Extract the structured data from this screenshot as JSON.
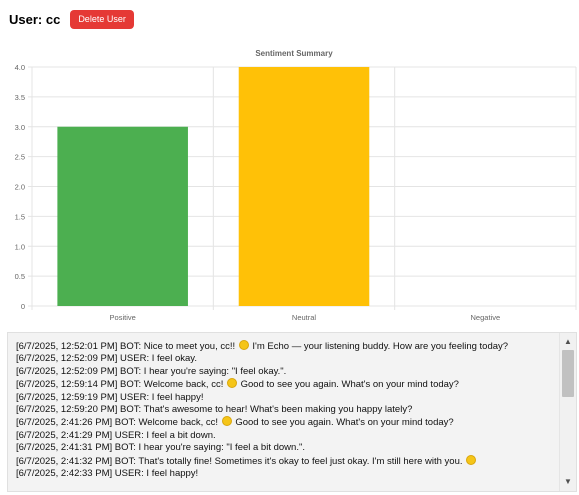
{
  "header": {
    "user_title": "User: cc",
    "delete_label": "Delete User"
  },
  "colors": {
    "delete_button": "#e53935",
    "positive": "#4caf50",
    "neutral": "#ffc107",
    "negative": "#f44336"
  },
  "chart_data": {
    "type": "bar",
    "title": "Sentiment Summary",
    "categories": [
      "Positive",
      "Neutral",
      "Negative"
    ],
    "values": [
      3,
      4,
      0
    ],
    "colors": [
      "#4caf50",
      "#ffc107",
      "#f44336"
    ],
    "ylim": [
      0,
      4
    ],
    "yticks": [
      "0",
      "0.5",
      "1.0",
      "1.5",
      "2.0",
      "2.5",
      "3.0",
      "3.5",
      "4.0"
    ],
    "grid": true,
    "xlabel": "",
    "ylabel": ""
  },
  "chat_log": {
    "lines": [
      {
        "text": "[6/7/2025, 12:52:01 PM] BOT: Nice to meet you, cc!! ",
        "emoji": "smile-emoji",
        "after": " I'm Echo — your listening buddy. How are you feeling today?"
      },
      {
        "text": "[6/7/2025, 12:52:09 PM] USER: I feel okay."
      },
      {
        "text": "[6/7/2025, 12:52:09 PM] BOT: I hear you're saying: \"I feel okay.\"."
      },
      {
        "text": "[6/7/2025, 12:59:14 PM] BOT: Welcome back, cc! ",
        "emoji": "smile-emoji",
        "after": " Good to see you again. What's on your mind today?"
      },
      {
        "text": "[6/7/2025, 12:59:19 PM] USER: I feel happy!"
      },
      {
        "text": "[6/7/2025, 12:59:20 PM] BOT: That's awesome to hear! What's been making you happy lately?"
      },
      {
        "text": "[6/7/2025, 2:41:26 PM] BOT: Welcome back, cc! ",
        "emoji": "smile-emoji",
        "after": " Good to see you again. What's on your mind today?"
      },
      {
        "text": "[6/7/2025, 2:41:29 PM] USER: I feel a bit down."
      },
      {
        "text": "[6/7/2025, 2:41:31 PM] BOT: I hear you're saying: \"I feel a bit down.\"."
      },
      {
        "text": "[6/7/2025, 2:41:32 PM] BOT: That's totally fine! Sometimes it's okay to feel just okay. I'm still here with you. ",
        "emoji": "smile-emoji",
        "after": ""
      },
      {
        "text": "[6/7/2025, 2:42:33 PM] USER: I feel happy!"
      }
    ]
  },
  "scrollbar": {
    "up_icon": "chevron-up-icon",
    "down_icon": "chevron-down-icon"
  }
}
